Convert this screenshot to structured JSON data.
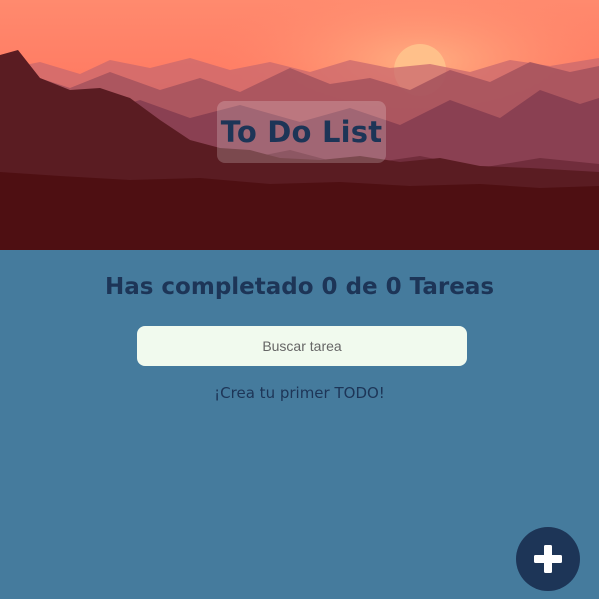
{
  "header": {
    "title": "To Do List",
    "background_image": "sunset-mountains",
    "colors": {
      "sky_top": "#ff7e6b",
      "sun": "#ffc98b",
      "mountain_dark": "#550c10"
    }
  },
  "counter": {
    "text": "Has completado 0 de 0 Tareas",
    "completed": 0,
    "total": 0
  },
  "search": {
    "value": "",
    "placeholder": "Buscar tarea"
  },
  "empty_state": {
    "message": "¡Crea tu primer TODO!"
  },
  "fab": {
    "icon": "plus-icon"
  },
  "colors": {
    "background": "#457b9d",
    "text_dark": "#1d3557",
    "input_bg": "#f1faee",
    "fab_bg": "#1d3557"
  }
}
